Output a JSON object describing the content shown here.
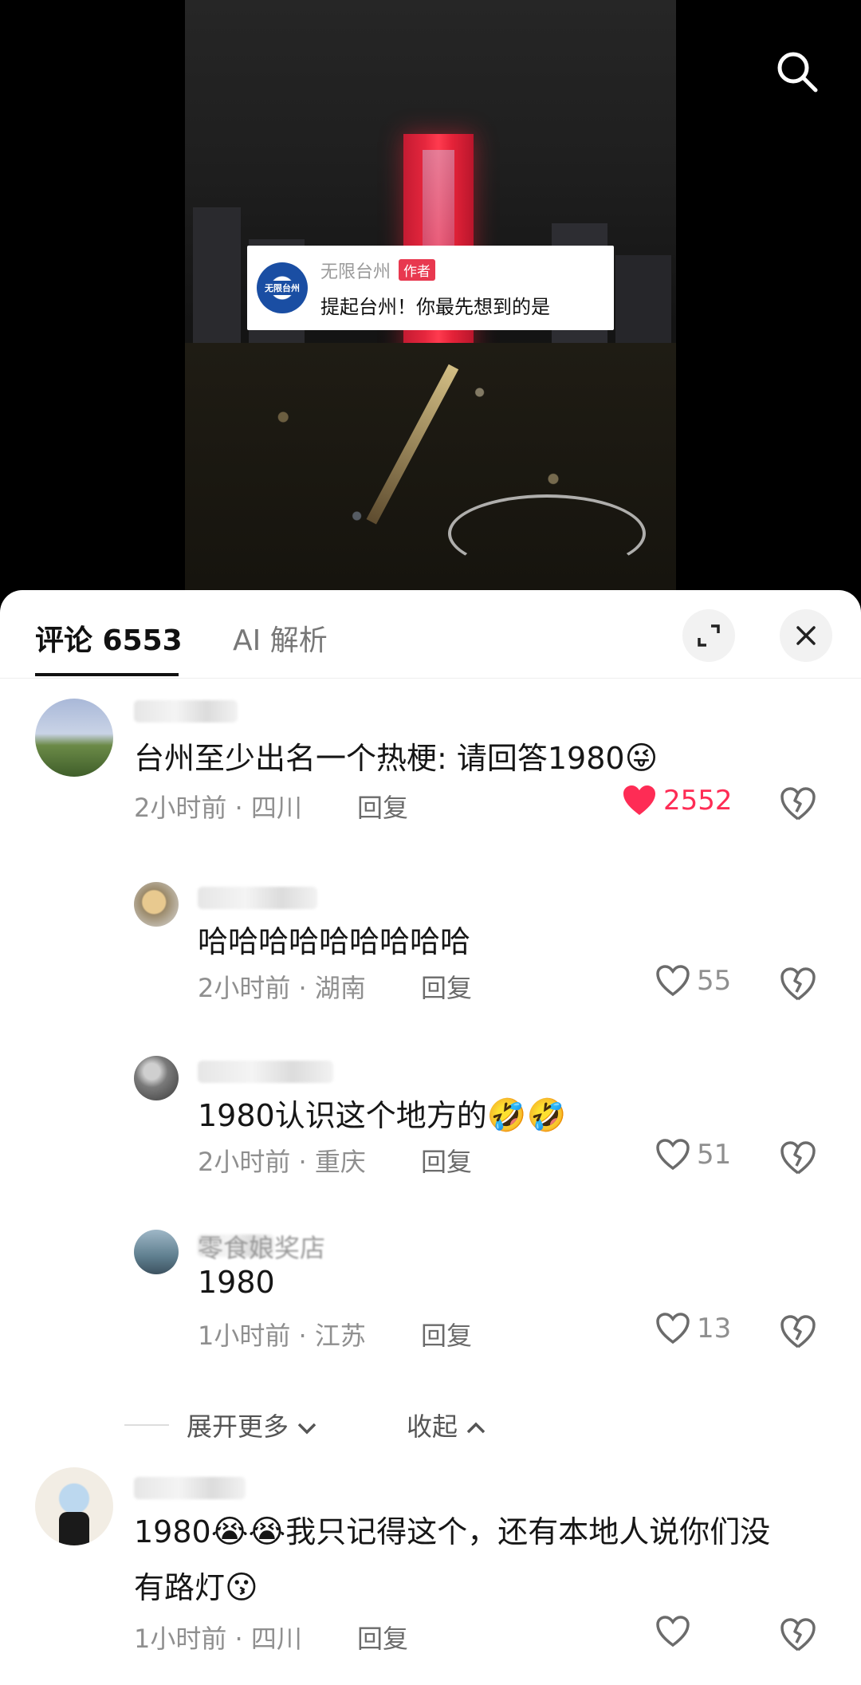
{
  "video": {
    "author_name": "无限台州",
    "author_tag": "作者",
    "author_logo_text": "无限台州",
    "caption": "提起台州！你最先想到的是"
  },
  "tabs": {
    "comments_label": "评论 6553",
    "ai_label": "AI 解析"
  },
  "icons": {
    "search": "search-icon",
    "expand": "expand-icon",
    "close": "close-icon",
    "heart": "heart-icon",
    "dislike": "dislike-heart-icon"
  },
  "colors": {
    "like_active": "#fe2c55",
    "tag": "#e8384f"
  },
  "comments": [
    {
      "text": "台州至少出名一个热梗: 请回答1980",
      "emoji": "😜",
      "time": "2小时前",
      "location": "四川",
      "reply": "回复",
      "likes": "2552",
      "liked": true
    },
    {
      "text": "哈哈哈哈哈哈哈哈哈",
      "time": "2小时前",
      "location": "湖南",
      "reply": "回复",
      "likes": "55"
    },
    {
      "text": "1980认识这个地方的",
      "emoji": "🤣🤣",
      "time": "2小时前",
      "location": "重庆",
      "reply": "回复",
      "likes": "51"
    },
    {
      "name_partial": "零食娘奖店",
      "text": "1980",
      "time": "1小时前",
      "location": "江苏",
      "reply": "回复",
      "likes": "13"
    },
    {
      "text_line1_a": "1980",
      "text_line1_emoji": "😭😭",
      "text_line1_b": "我只记得这个，还有本地人说你们没",
      "text_line2": "有路灯",
      "text_line2_emoji": "😗",
      "time": "1小时前",
      "location": "四川",
      "reply": "回复"
    }
  ],
  "thread": {
    "expand_more": "展开更多",
    "collapse": "收起"
  },
  "meta_separator": "·"
}
